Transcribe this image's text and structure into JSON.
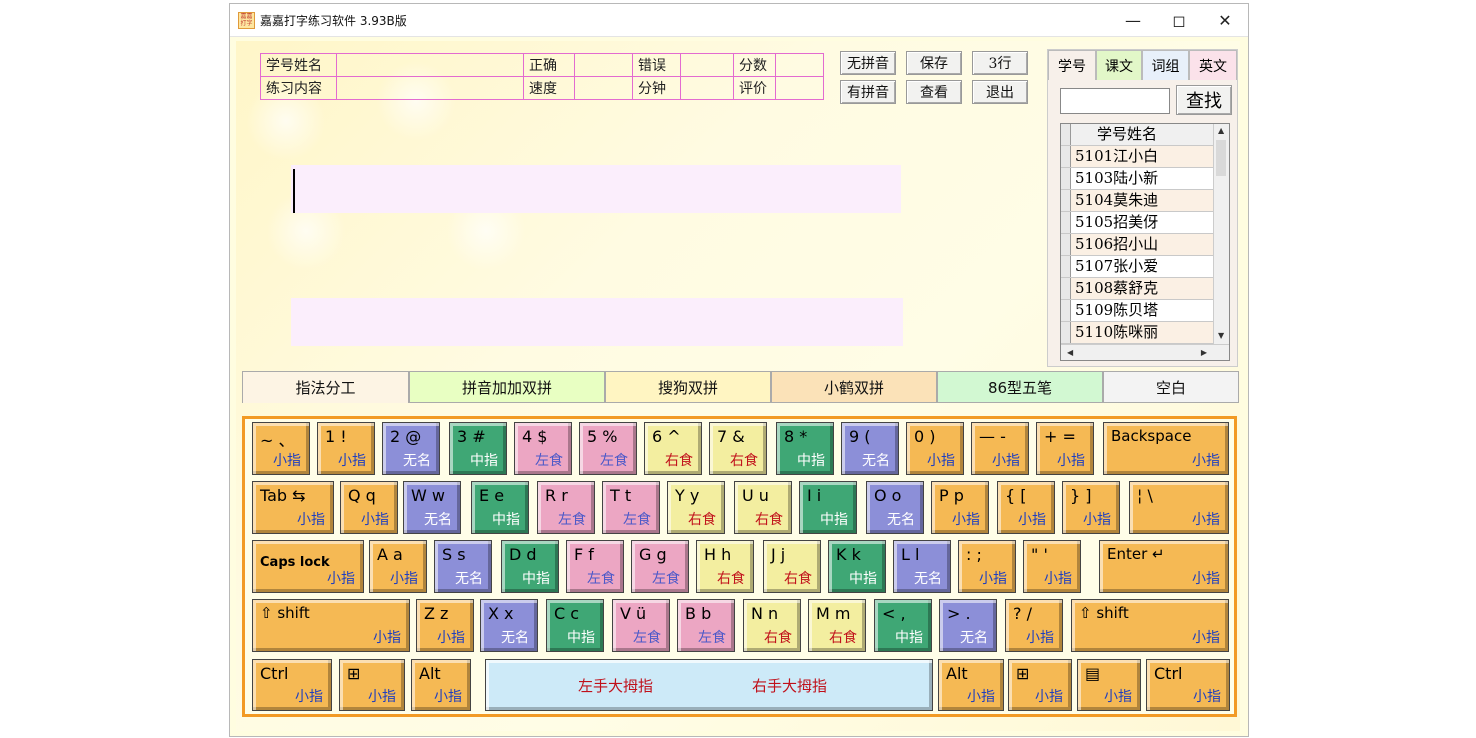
{
  "window": {
    "title": "嘉嘉打字练习软件  3.93B版",
    "icon_text": "嘉嘉打字",
    "minimize_icon": "minimize-icon",
    "maximize_icon": "maximize-icon",
    "close_icon": "close-icon"
  },
  "info": {
    "row1": [
      "学号姓名",
      "",
      "正确",
      "",
      "错误",
      "",
      "分数",
      ""
    ],
    "row2": [
      "练习内容",
      "",
      "速度",
      "",
      "分钟",
      "",
      "评价",
      ""
    ]
  },
  "buttons": {
    "no_pinyin": "无拼音",
    "save": "保存",
    "rows3": "3行",
    "has_pinyin": "有拼音",
    "view": "查看",
    "exit": "退出"
  },
  "right_tabs": [
    "学号",
    "课文",
    "词组",
    "英文"
  ],
  "search": {
    "value": "",
    "button": "查找"
  },
  "student_grid": {
    "header": "学号姓名",
    "rows": [
      "5101江小白",
      "5103陆小新",
      "5104莫朱迪",
      "5105招美伢",
      "5106招小山",
      "5107张小爱",
      "5108蔡舒克",
      "5109陈贝塔",
      "5110陈咪丽"
    ]
  },
  "main_tabs": [
    "指法分工",
    "拼音加加双拼",
    "搜狗双拼",
    "小鹤双拼",
    "86型五笔",
    "空白"
  ],
  "keyboard": {
    "row1": [
      {
        "top": "~ 、",
        "bottom": "小指",
        "color": "or"
      },
      {
        "top": "1 !",
        "bottom": "小指",
        "color": "or"
      },
      {
        "top": "2 @",
        "bottom": "无名",
        "color": "pu"
      },
      {
        "top": "3 #",
        "bottom": "中指",
        "color": "gr"
      },
      {
        "top": "4 $",
        "bottom": "左食",
        "color": "pk"
      },
      {
        "top": "5 %",
        "bottom": "左食",
        "color": "pk"
      },
      {
        "top": "6 ^",
        "bottom": "右食",
        "color": "yl"
      },
      {
        "top": "7 &",
        "bottom": "右食",
        "color": "yl"
      },
      {
        "top": "8 *",
        "bottom": "中指",
        "color": "gr"
      },
      {
        "top": "9 (",
        "bottom": "无名",
        "color": "pu"
      },
      {
        "top": "0 )",
        "bottom": "小指",
        "color": "or"
      },
      {
        "top": "— -",
        "bottom": "小指",
        "color": "or"
      },
      {
        "top": "+ =",
        "bottom": "小指",
        "color": "or"
      },
      {
        "top": "Backspace",
        "bottom": "小指",
        "color": "or"
      }
    ],
    "row2": [
      {
        "top": "Tab ⇆",
        "bottom": "小指",
        "color": "or"
      },
      {
        "top": "Q q",
        "bottom": "小指",
        "color": "or"
      },
      {
        "top": "W w",
        "bottom": "无名",
        "color": "pu"
      },
      {
        "top": "E e",
        "bottom": "中指",
        "color": "gr"
      },
      {
        "top": "R r",
        "bottom": "左食",
        "color": "pk"
      },
      {
        "top": "T t",
        "bottom": "左食",
        "color": "pk"
      },
      {
        "top": "Y y",
        "bottom": "右食",
        "color": "yl"
      },
      {
        "top": "U u",
        "bottom": "右食",
        "color": "yl"
      },
      {
        "top": "I i",
        "bottom": "中指",
        "color": "gr"
      },
      {
        "top": "O o",
        "bottom": "无名",
        "color": "pu"
      },
      {
        "top": "P p",
        "bottom": "小指",
        "color": "or"
      },
      {
        "top": "{ [",
        "bottom": "小指",
        "color": "or"
      },
      {
        "top": "} ]",
        "bottom": "小指",
        "color": "or"
      },
      {
        "top": "¦ \\",
        "bottom": "小指",
        "color": "or"
      }
    ],
    "row3": [
      {
        "top": "Caps lock",
        "bottom": "小指",
        "color": "or"
      },
      {
        "top": "A a",
        "bottom": "小指",
        "color": "or"
      },
      {
        "top": "S s",
        "bottom": "无名",
        "color": "pu"
      },
      {
        "top": "D d",
        "bottom": "中指",
        "color": "gr"
      },
      {
        "top": "F f",
        "bottom": "左食",
        "color": "pk"
      },
      {
        "top": "G g",
        "bottom": "左食",
        "color": "pk"
      },
      {
        "top": "H h",
        "bottom": "右食",
        "color": "yl"
      },
      {
        "top": "J j",
        "bottom": "右食",
        "color": "yl"
      },
      {
        "top": "K k",
        "bottom": "中指",
        "color": "gr"
      },
      {
        "top": "L l",
        "bottom": "无名",
        "color": "pu"
      },
      {
        "top": ": ;",
        "bottom": "小指",
        "color": "or"
      },
      {
        "top": "\" '",
        "bottom": "小指",
        "color": "or"
      },
      {
        "top": "Enter ↵",
        "bottom": "小指",
        "color": "or"
      }
    ],
    "row4": [
      {
        "top": "⇧ shift",
        "bottom": "小指",
        "color": "or"
      },
      {
        "top": "Z z",
        "bottom": "小指",
        "color": "or"
      },
      {
        "top": "X x",
        "bottom": "无名",
        "color": "pu"
      },
      {
        "top": "C c",
        "bottom": "中指",
        "color": "gr"
      },
      {
        "top": "V ü",
        "bottom": "左食",
        "color": "pk"
      },
      {
        "top": "B b",
        "bottom": "左食",
        "color": "pk"
      },
      {
        "top": "N n",
        "bottom": "右食",
        "color": "yl"
      },
      {
        "top": "M m",
        "bottom": "右食",
        "color": "yl"
      },
      {
        "top": "< ,",
        "bottom": "中指",
        "color": "gr"
      },
      {
        "top": "> .",
        "bottom": "无名",
        "color": "pu"
      },
      {
        "top": "? /",
        "bottom": "小指",
        "color": "or"
      },
      {
        "top": "⇧ shift",
        "bottom": "小指",
        "color": "or"
      }
    ],
    "row5_left": [
      {
        "top": "Ctrl",
        "bottom": "小指",
        "color": "or"
      },
      {
        "top": "⊞",
        "bottom": "小指",
        "color": "or"
      },
      {
        "top": "Alt",
        "bottom": "小指",
        "color": "or"
      }
    ],
    "space": {
      "left": "左手大拇指",
      "right": "右手大拇指"
    },
    "row5_right": [
      {
        "top": "Alt",
        "bottom": "小指",
        "color": "or"
      },
      {
        "top": "⊞",
        "bottom": "小指",
        "color": "or"
      },
      {
        "top": "▤",
        "bottom": "小指",
        "color": "or"
      },
      {
        "top": "Ctrl",
        "bottom": "小指",
        "color": "or"
      }
    ]
  }
}
